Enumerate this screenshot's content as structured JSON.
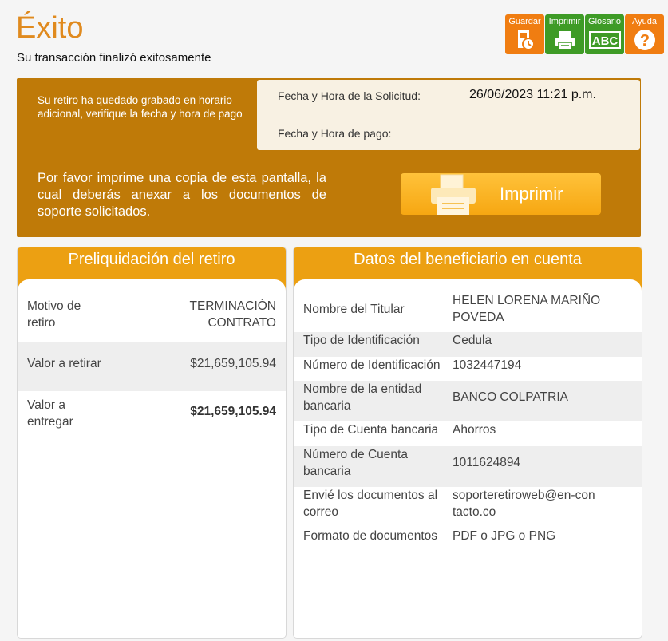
{
  "header": {
    "title": "Éxito",
    "subtitle": "Su transacción finalizó exitosamente"
  },
  "toolbar": {
    "buttons": [
      {
        "label": "Guardar",
        "icon": "save-icon"
      },
      {
        "label": "Imprimir",
        "icon": "printer-icon"
      },
      {
        "label": "Glosario",
        "icon": "abc-icon"
      },
      {
        "label": "Ayuda",
        "icon": "help-icon"
      }
    ]
  },
  "banner": {
    "message": "Su retiro ha quedado grabado en horario adicional, verifique la fecha y hora de pago",
    "request_label": "Fecha y Hora de la Solicitud:",
    "request_value": "26/06/2023 11:21 p.m.",
    "payment_label": "Fecha y Hora de pago:",
    "print_message": "Por favor imprime una copia de esta pantalla, la cual deberás anexar a los documentos de soporte solicitados.",
    "print_button": "Imprimir"
  },
  "preliquidation": {
    "title": "Preliquidación del retiro",
    "rows": [
      {
        "label": "Motivo de retiro",
        "value": "TERMINACIÓN CONTRATO"
      },
      {
        "label": "Valor a retirar",
        "value": "$21,659,105.94"
      },
      {
        "label": "Valor a entregar",
        "value": "$21,659,105.94"
      }
    ]
  },
  "beneficiary": {
    "title": "Datos del beneficiario en cuenta",
    "rows": [
      {
        "label": "Nombre del Titular",
        "value": "HELEN LORENA MARIÑO POVEDA"
      },
      {
        "label": "Tipo de Identificación",
        "value": "Cedula"
      },
      {
        "label": "Número de Identificación",
        "value": "1032447194"
      },
      {
        "label": "Nombre de la entidad bancaria",
        "value": "BANCO COLPATRIA"
      },
      {
        "label": "Tipo de Cuenta bancaria",
        "value": "Ahorros"
      },
      {
        "label": "Número de Cuenta bancaria",
        "value": "1011624894"
      },
      {
        "label": "Envié los documentos al correo",
        "value": "soporteretiroweb@en-contacto.co"
      },
      {
        "label": "Formato de documentos",
        "value": "PDF o JPG o PNG"
      }
    ]
  },
  "colors": {
    "accent": "#e08a1e",
    "banner": "#bf7a08",
    "panel_header": "#eca012",
    "toolbar_orange": "#f07d11",
    "toolbar_green": "#3e9b26"
  }
}
